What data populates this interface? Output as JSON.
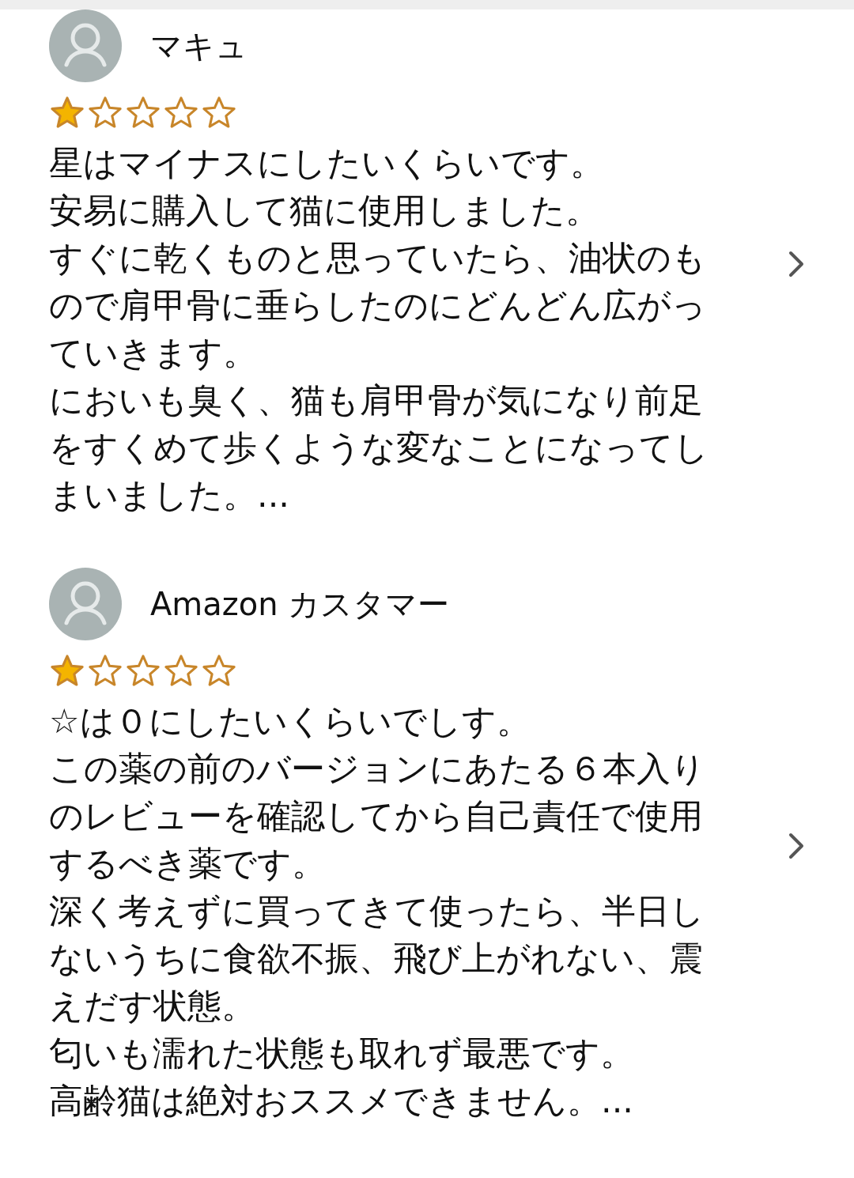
{
  "reviews": [
    {
      "author": "マキュ",
      "stars": 1,
      "paragraphs": [
        "星はマイナスにしたいくらいです。",
        "安易に購入して猫に使用しました。",
        "すぐに乾くものと思っていたら、油状のもので肩甲骨に垂らしたのにどんどん広がっていきます。",
        "においも臭く、猫も肩甲骨が気になり前足をすくめて歩くような変なことになってしまいました。..."
      ]
    },
    {
      "author": "Amazon カスタマー",
      "stars": 1,
      "paragraphs": [
        "☆は０にしたいくらいでしす。",
        "この薬の前のバージョンにあたる６本入りのレビューを確認してから自己責任で使用するべき薬です。",
        "深く考えずに買ってきて使ったら、半日しないうちに食欲不振、飛び上がれない、震えだす状態。",
        "匂いも濡れた状態も取れず最悪です。",
        "高齢猫は絶対おススメできません。..."
      ]
    }
  ]
}
